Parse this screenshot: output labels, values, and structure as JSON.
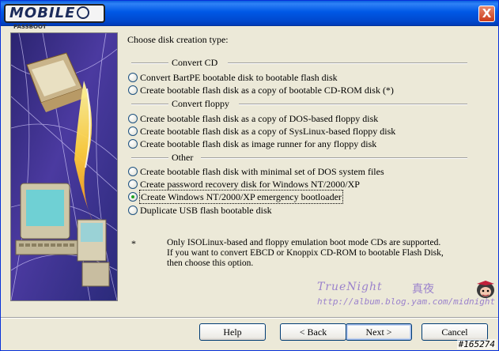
{
  "window": {
    "logo_text": "MOBILE",
    "logo_sub": "PASSBOOT",
    "close_label": "X"
  },
  "main": {
    "prompt": "Choose disk creation type:",
    "sections": [
      {
        "title": "Convert CD",
        "options": [
          {
            "label": "Convert BartPE bootable disk to bootable flash disk",
            "checked": false
          },
          {
            "label": "Create bootable flash disk as a copy of bootable CD-ROM disk (*)",
            "checked": false
          }
        ]
      },
      {
        "title": "Convert floppy",
        "options": [
          {
            "label": "Create bootable flash disk as a copy of DOS-based floppy disk",
            "checked": false
          },
          {
            "label": "Create bootable flash disk as a copy of SysLinux-based floppy disk",
            "checked": false
          },
          {
            "label": "Create bootable flash disk as image runner for any floppy disk",
            "checked": false
          }
        ]
      },
      {
        "title": "Other",
        "options": [
          {
            "label": "Create bootable flash disk with minimal set of DOS system files",
            "checked": false
          },
          {
            "label": "Create password recovery disk for Windows NT/2000/XP",
            "checked": false
          },
          {
            "label": "Create Windows NT/2000/XP emergency bootloader",
            "checked": true
          },
          {
            "label": "Duplicate USB flash bootable disk",
            "checked": false
          }
        ]
      }
    ],
    "note_marker": "*",
    "note_lines": [
      "Only ISOLinux-based and floppy emulation boot mode CDs are supported.",
      "If you want to convert EBCD or Knoppix CD-ROM to bootable Flash Disk,",
      "then choose this option."
    ]
  },
  "watermark": {
    "name": "TrueNight",
    "cn": "真夜",
    "url": "http://album.blog.yam.com/midnight"
  },
  "buttons": {
    "help": "Help",
    "back": "< Back",
    "next": "Next >",
    "cancel": "Cancel"
  },
  "image_tag": "#165274",
  "colors": {
    "titlebar": "#0058e6",
    "dialog_bg": "#ece9d8",
    "watermark": "#9b82cc"
  }
}
